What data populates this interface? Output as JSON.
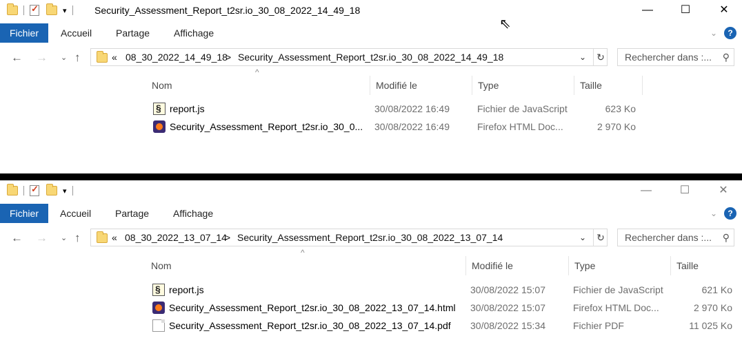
{
  "windows": [
    {
      "title": "Security_Assessment_Report_t2sr.io_30_08_2022_14_49_18",
      "ribbon": {
        "file": "Fichier",
        "home": "Accueil",
        "share": "Partage",
        "view": "Affichage"
      },
      "address": {
        "overflow": "«",
        "parent": "08_30_2022_14_49_18",
        "sep": ">",
        "current": "Security_Assessment_Report_t2sr.io_30_08_2022_14_49_18"
      },
      "search_placeholder": "Rechercher dans :...",
      "columns": {
        "name": "Nom",
        "modified": "Modifié le",
        "type": "Type",
        "size": "Taille"
      },
      "files": [
        {
          "icon": "javascript-file-icon",
          "name": "report.js",
          "modified": "30/08/2022 16:49",
          "type": "Fichier de JavaScript",
          "size": "623 Ko"
        },
        {
          "icon": "firefox-html-icon",
          "name": "Security_Assessment_Report_t2sr.io_30_0...",
          "modified": "30/08/2022 16:49",
          "type": "Firefox HTML Doc...",
          "size": "2 970 Ko"
        }
      ]
    },
    {
      "title": "",
      "ribbon": {
        "file": "Fichier",
        "home": "Accueil",
        "share": "Partage",
        "view": "Affichage"
      },
      "address": {
        "overflow": "«",
        "parent": "08_30_2022_13_07_14",
        "sep": ">",
        "current": "Security_Assessment_Report_t2sr.io_30_08_2022_13_07_14"
      },
      "search_placeholder": "Rechercher dans :...",
      "columns": {
        "name": "Nom",
        "modified": "Modifié le",
        "type": "Type",
        "size": "Taille"
      },
      "files": [
        {
          "icon": "javascript-file-icon",
          "name": "report.js",
          "modified": "30/08/2022 15:07",
          "type": "Fichier de JavaScript",
          "size": "621 Ko"
        },
        {
          "icon": "firefox-html-icon",
          "name": "Security_Assessment_Report_t2sr.io_30_08_2022_13_07_14.html",
          "modified": "30/08/2022 15:07",
          "type": "Firefox HTML Doc...",
          "size": "2 970 Ko"
        },
        {
          "icon": "pdf-file-icon",
          "name": "Security_Assessment_Report_t2sr.io_30_08_2022_13_07_14.pdf",
          "modified": "30/08/2022 15:34",
          "type": "Fichier PDF",
          "size": "11 025 Ko"
        }
      ]
    }
  ],
  "glyphs": {
    "minimize": "—",
    "maximize": "☐",
    "close": "✕",
    "back": "←",
    "forward": "→",
    "recent": "⌄",
    "up": "↑",
    "dropdown": "⌄",
    "refresh": "↻",
    "search": "⚲",
    "help": "?",
    "sort": "^",
    "qa_dropdown": "▾"
  },
  "colors": {
    "file_tab": "#1a64b3",
    "folder": "#f8d775"
  }
}
